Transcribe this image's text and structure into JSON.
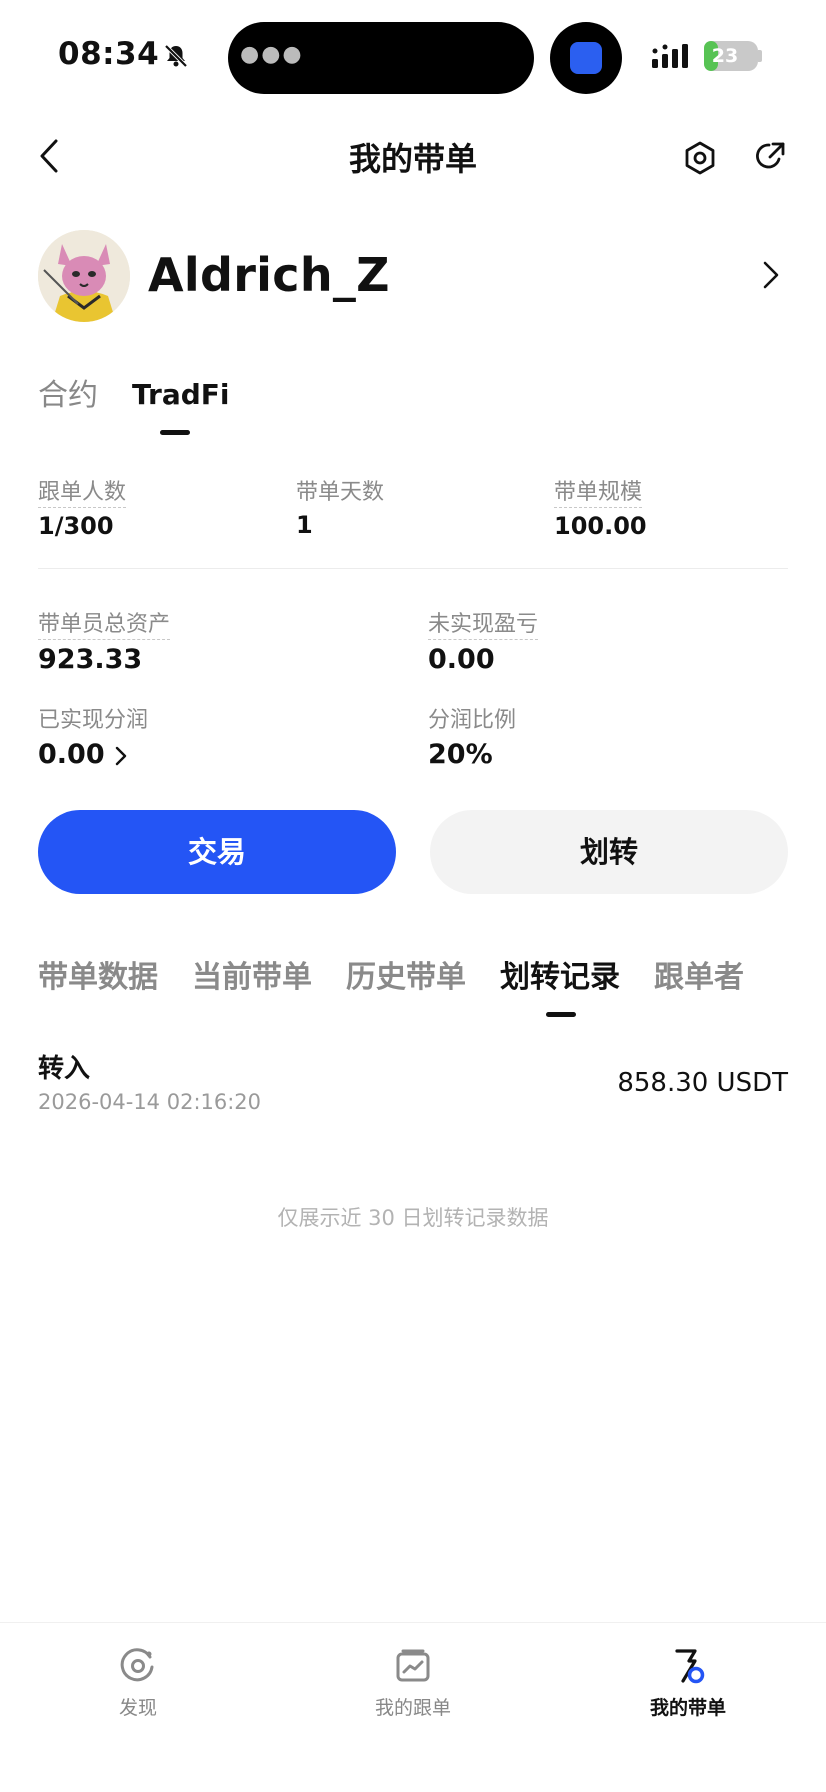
{
  "status_bar": {
    "time": "08:34",
    "battery": "23",
    "battery_level": 0.23
  },
  "header": {
    "title": "我的带单"
  },
  "profile": {
    "username": "Aldrich_Z"
  },
  "top_tabs": [
    {
      "label": "合约"
    },
    {
      "label": "TradFi"
    }
  ],
  "stats_row1": [
    {
      "label": "跟单人数",
      "value": "1/300"
    },
    {
      "label": "带单天数",
      "value": "1"
    },
    {
      "label": "带单规模",
      "value": "100.00"
    }
  ],
  "stats_row2": [
    {
      "label": "带单员总资产",
      "value": "923.33"
    },
    {
      "label": "未实现盈亏",
      "value": "0.00"
    },
    {
      "label": "已实现分润",
      "value": "0.00"
    },
    {
      "label": "分润比例",
      "value": "20%"
    }
  ],
  "buttons": {
    "trade": "交易",
    "transfer": "划转"
  },
  "section_tabs": [
    {
      "label": "带单数据"
    },
    {
      "label": "当前带单"
    },
    {
      "label": "历史带单"
    },
    {
      "label": "划转记录"
    },
    {
      "label": "跟单者"
    }
  ],
  "record": {
    "type": "转入",
    "time": "2026-04-14 02:16:20",
    "amount": "858.30 USDT"
  },
  "footnote": "仅展示近 30 日划转记录数据",
  "bottom_nav": [
    {
      "label": "发现",
      "icon": "discover-icon"
    },
    {
      "label": "我的跟单",
      "icon": "chart-card-icon"
    },
    {
      "label": "我的带单",
      "icon": "flag-badge-icon"
    }
  ]
}
